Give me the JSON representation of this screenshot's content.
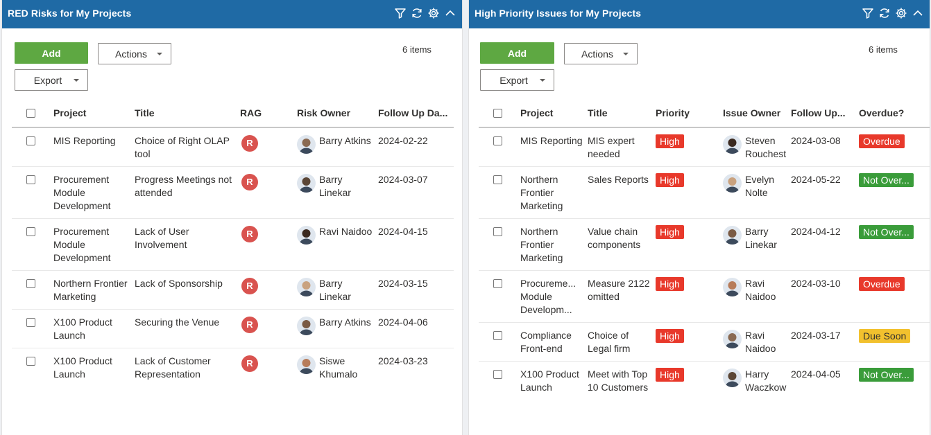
{
  "left_panel": {
    "title": "RED Risks for My Projects",
    "add_label": "Add",
    "actions_label": "Actions",
    "export_label": "Export",
    "count": "6 items",
    "columns": [
      "Project",
      "Title",
      "RAG",
      "Risk Owner",
      "Follow Up Da..."
    ],
    "rows": [
      {
        "project": "MIS Reporting",
        "title": "Choice of Right OLAP tool",
        "rag": "R",
        "owner": "Barry Atkins",
        "follow_up": "2024-02-22"
      },
      {
        "project": "Procurement Module Development",
        "title": "Progress Meetings not attended",
        "rag": "R",
        "owner": "Barry Linekar",
        "follow_up": "2024-03-07"
      },
      {
        "project": "Procurement Module Development",
        "title": "Lack of User Involvement",
        "rag": "R",
        "owner": "Ravi Naidoo",
        "follow_up": "2024-04-15"
      },
      {
        "project": "Northern Frontier Marketing",
        "title": "Lack of Sponsorship",
        "rag": "R",
        "owner": "Barry Linekar",
        "follow_up": "2024-03-15"
      },
      {
        "project": "X100 Product Launch",
        "title": "Securing the Venue",
        "rag": "R",
        "owner": "Barry Atkins",
        "follow_up": "2024-04-06"
      },
      {
        "project": "X100 Product Launch",
        "title": "Lack of Customer Representation",
        "rag": "R",
        "owner": "Siswe Khumalo",
        "follow_up": "2024-03-23"
      }
    ]
  },
  "right_panel": {
    "title": "High Priority Issues for My Projects",
    "add_label": "Add",
    "actions_label": "Actions",
    "export_label": "Export",
    "count": "6 items",
    "columns": [
      "Project",
      "Title",
      "Priority",
      "Issue Owner",
      "Follow Up...",
      "Overdue?"
    ],
    "rows": [
      {
        "project": "MIS Reporting",
        "title": "MIS expert needed",
        "priority": "High",
        "owner": "Steven Rouchest",
        "follow_up": "2024-03-08",
        "overdue": "Overdue"
      },
      {
        "project": "Northern Frontier Marketing",
        "title": "Sales Reports",
        "priority": "High",
        "owner": "Evelyn Nolte",
        "follow_up": "2024-05-22",
        "overdue": "Not Over..."
      },
      {
        "project": "Northern Frontier Marketing",
        "title": "Value chain components",
        "priority": "High",
        "owner": "Barry Linekar",
        "follow_up": "2024-04-12",
        "overdue": "Not Over..."
      },
      {
        "project": "Procureme... Module Developm...",
        "title": "Measure 2122 omitted",
        "priority": "High",
        "owner": "Ravi Naidoo",
        "follow_up": "2024-03-10",
        "overdue": "Overdue"
      },
      {
        "project": "Compliance Front-end",
        "title": "Choice of Legal firm",
        "priority": "High",
        "owner": "Ravi Naidoo",
        "follow_up": "2024-03-17",
        "overdue": "Due Soon"
      },
      {
        "project": "X100 Product Launch",
        "title": "Meet with Top 10 Customers",
        "priority": "High",
        "owner": "Harry Waczkow",
        "follow_up": "2024-04-05",
        "overdue": "Not Over..."
      }
    ]
  },
  "colors": {
    "header_bg": "#1f6aa5",
    "add_button": "#5ea842",
    "rag_red": "#d9534f",
    "priority_high": "#e8392b",
    "overdue": "#e8392b",
    "not_overdue": "#3a9c3a",
    "due_soon": "#f2c12e"
  },
  "icons": [
    "filter-icon",
    "refresh-icon",
    "gear-icon",
    "chevron-up-icon"
  ]
}
